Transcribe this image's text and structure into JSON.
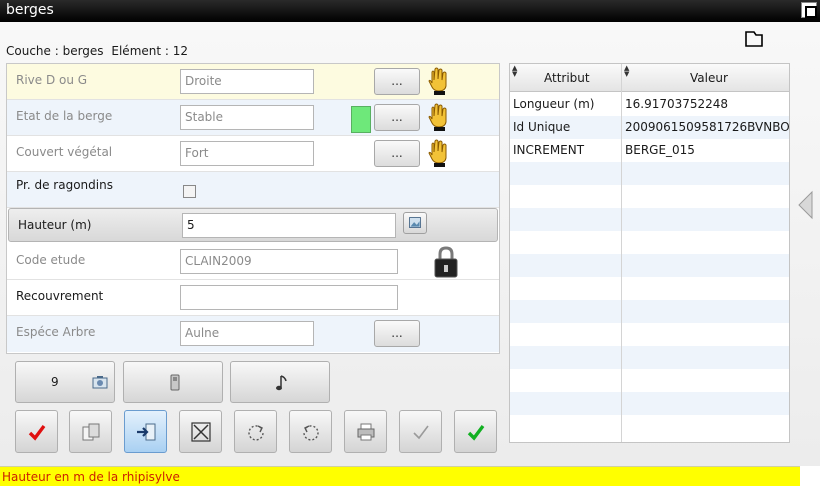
{
  "window": {
    "title": "berges"
  },
  "info": {
    "layer_label": "Couche : berges",
    "element_label": "Elément : 12"
  },
  "form": {
    "rows": [
      {
        "label": "Rive D ou G",
        "value": "Droite",
        "button": "..."
      },
      {
        "label": "Etat de la berge",
        "value": "Stable",
        "button": "..."
      },
      {
        "label": "Couvert végétal",
        "value": "Fort",
        "button": "..."
      },
      {
        "label": "Pr. de ragondins"
      },
      {
        "label": "Hauteur (m)",
        "value": "5"
      },
      {
        "label": "Code etude",
        "value": "CLAIN2009"
      },
      {
        "label": "Recouvrement",
        "value": ""
      },
      {
        "label": "Espéce Arbre",
        "value": "Aulne",
        "button": "..."
      }
    ]
  },
  "actions": {
    "counter": "9"
  },
  "grid": {
    "headers": [
      "Attribut",
      "Valeur"
    ],
    "rows": [
      {
        "attr": "Longueur (m)",
        "value": "16.91703752248"
      },
      {
        "attr": "Id Unique",
        "value": "200906150958172​6BVNBO"
      },
      {
        "attr": "INCREMENT",
        "value": "BERGE_015"
      }
    ]
  },
  "status": {
    "text": "Hauteur en m de la rhipisylve"
  },
  "colors": {
    "status_bg": "#ffff00",
    "status_text": "#cc2000",
    "validity": "#6ee87a"
  }
}
